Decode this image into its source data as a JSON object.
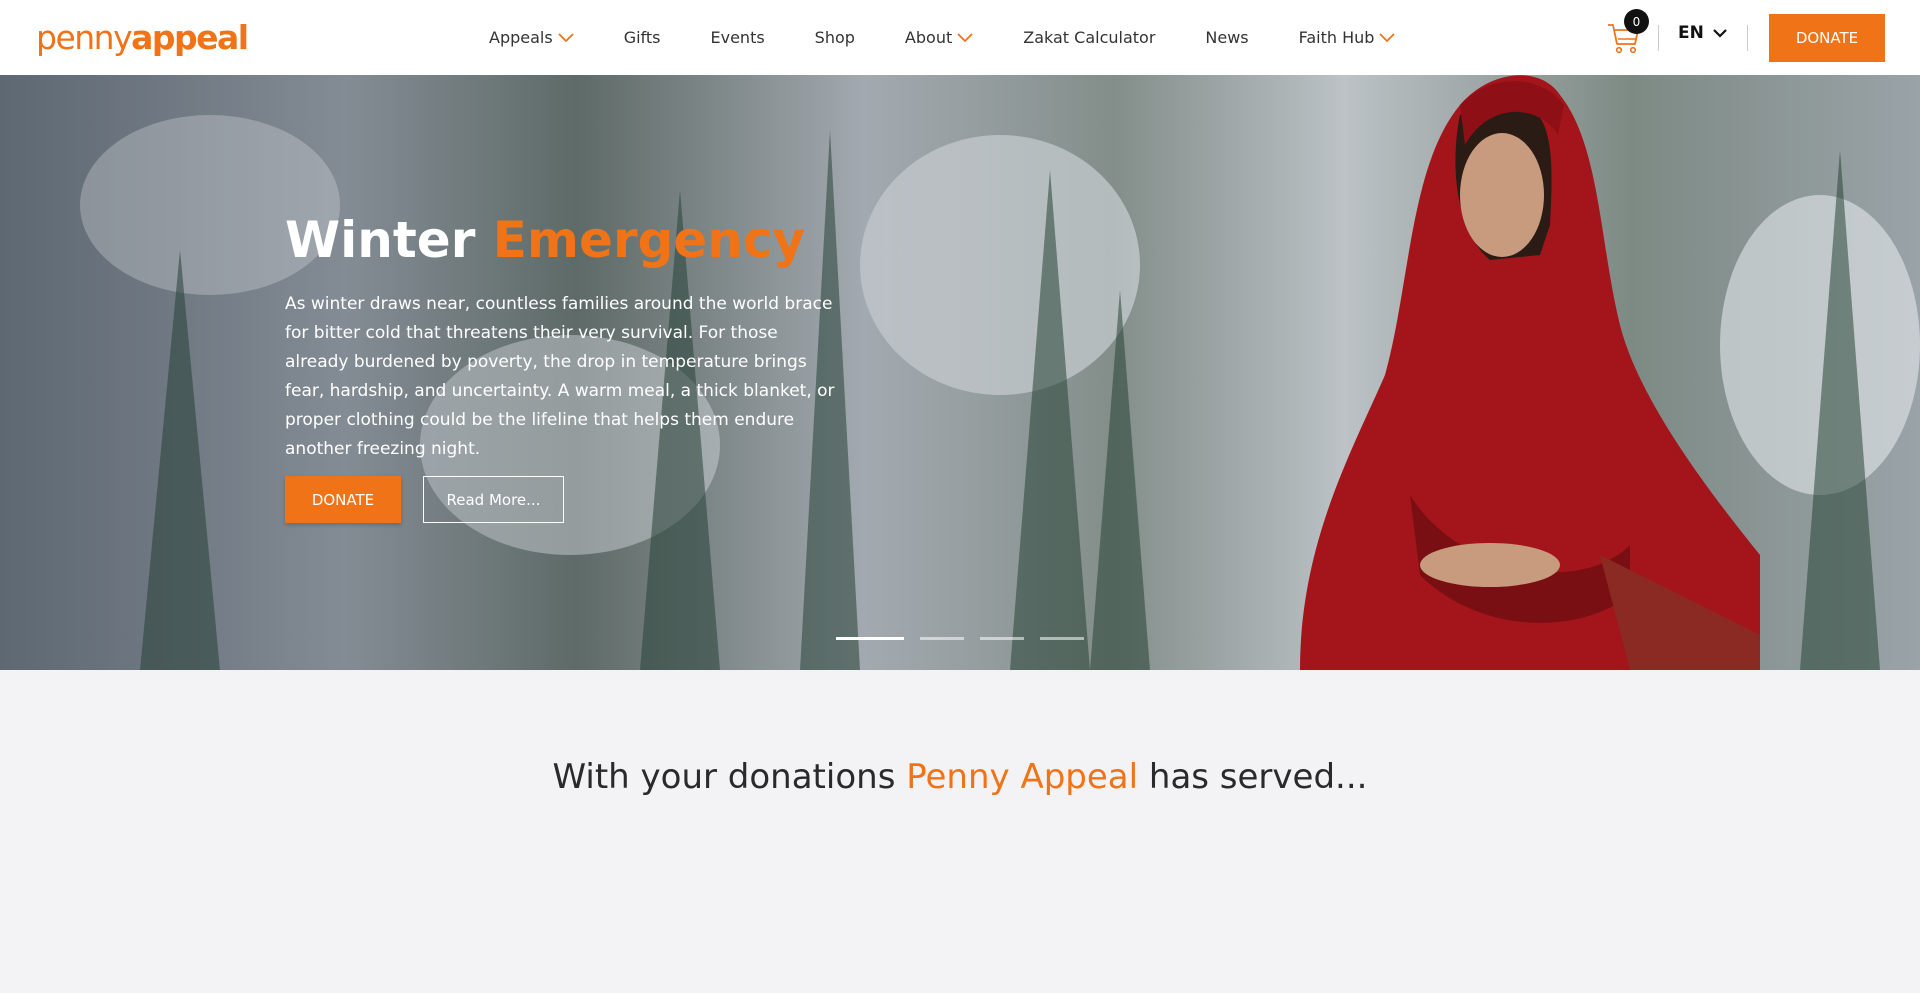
{
  "header": {
    "logo": {
      "part1": "penny",
      "part2": "appeal"
    },
    "nav": [
      {
        "label": "Appeals",
        "dropdown": true
      },
      {
        "label": "Gifts",
        "dropdown": false
      },
      {
        "label": "Events",
        "dropdown": false
      },
      {
        "label": "Shop",
        "dropdown": false
      },
      {
        "label": "About",
        "dropdown": true
      },
      {
        "label": "Zakat Calculator",
        "dropdown": false
      },
      {
        "label": "News",
        "dropdown": false
      },
      {
        "label": "Faith Hub",
        "dropdown": true
      }
    ],
    "cart_count": "0",
    "language": "EN",
    "donate_label": "DONATE"
  },
  "hero": {
    "title_part1": "Winter",
    "title_part2": "Emergency",
    "text": "As winter draws near, countless families around the world brace for bitter cold that threatens their very survival. For those already burdened by poverty, the drop in temperature brings fear, hardship, and uncertainty. A warm meal, a thick blanket, or proper clothing could be the lifeline that helps them endure another freezing night.",
    "donate_label": "DONATE",
    "read_more_label": "Read More...",
    "slides": 4,
    "active_slide": 0
  },
  "served": {
    "part1": "With your donations",
    "part2": "Penny Appeal",
    "part3": "has served..."
  },
  "colors": {
    "brand": "#f07318",
    "hero_scarf": "#a3151b"
  }
}
